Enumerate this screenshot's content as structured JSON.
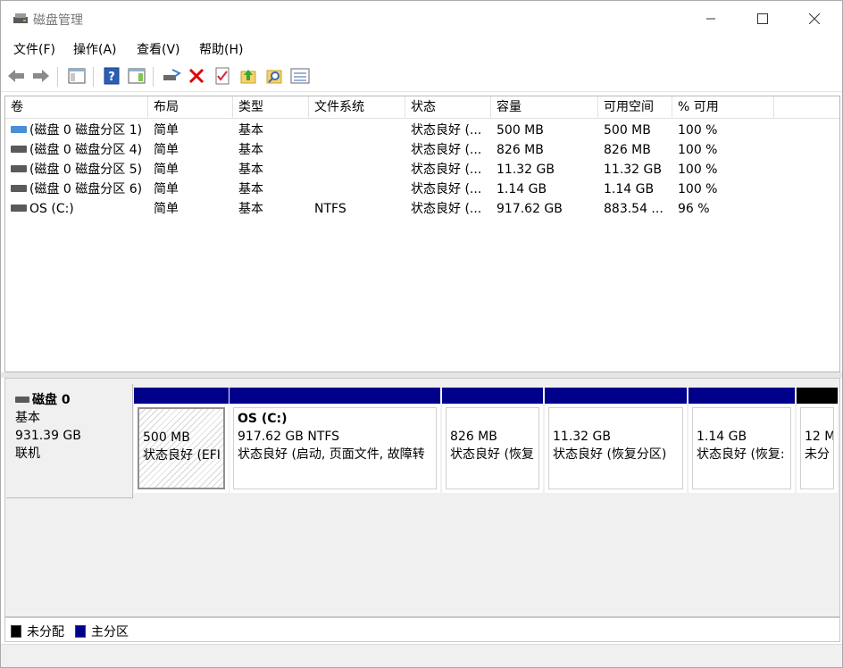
{
  "window": {
    "title": "磁盘管理"
  },
  "menu": [
    {
      "label": "文件(F)"
    },
    {
      "label": "操作(A)"
    },
    {
      "label": "查看(V)"
    },
    {
      "label": "帮助(H)"
    }
  ],
  "toolbar": {
    "icons": [
      "back-arrow-icon",
      "forward-arrow-icon",
      "console-tree-icon",
      "help-icon",
      "action-pane-icon",
      "connect-drive-icon",
      "delete-icon",
      "properties-check-icon",
      "up-folder-icon",
      "search-folder-icon",
      "settings-list-icon"
    ]
  },
  "volume_list": {
    "columns": [
      "卷",
      "布局",
      "类型",
      "文件系统",
      "状态",
      "容量",
      "可用空间",
      "% 可用"
    ],
    "rows": [
      {
        "volume": "(磁盘 0 磁盘分区 1)",
        "layout": "简单",
        "type": "基本",
        "fs": "",
        "status": "状态良好 (...",
        "capacity": "500 MB",
        "free": "500 MB",
        "pct": "100 %"
      },
      {
        "volume": "(磁盘 0 磁盘分区 4)",
        "layout": "简单",
        "type": "基本",
        "fs": "",
        "status": "状态良好 (...",
        "capacity": "826 MB",
        "free": "826 MB",
        "pct": "100 %"
      },
      {
        "volume": "(磁盘 0 磁盘分区 5)",
        "layout": "简单",
        "type": "基本",
        "fs": "",
        "status": "状态良好 (...",
        "capacity": "11.32 GB",
        "free": "11.32 GB",
        "pct": "100 %"
      },
      {
        "volume": "(磁盘 0 磁盘分区 6)",
        "layout": "简单",
        "type": "基本",
        "fs": "",
        "status": "状态良好 (...",
        "capacity": "1.14 GB",
        "free": "1.14 GB",
        "pct": "100 %"
      },
      {
        "volume": "OS (C:)",
        "layout": "简单",
        "type": "基本",
        "fs": "NTFS",
        "status": "状态良好 (...",
        "capacity": "917.62 GB",
        "free": "883.54 ...",
        "pct": "96 %"
      }
    ]
  },
  "disk": {
    "name": "磁盘 0",
    "type": "基本",
    "size": "931.39 GB",
    "state": "联机",
    "partitions": [
      {
        "title": "",
        "size": "500 MB",
        "status": "状态良好 (EFI"
      },
      {
        "title": "OS  (C:)",
        "size": "917.62 GB NTFS",
        "status": "状态良好 (启动, 页面文件, 故障转"
      },
      {
        "title": "",
        "size": "826 MB",
        "status": "状态良好 (恢复"
      },
      {
        "title": "",
        "size": "11.32 GB",
        "status": "状态良好 (恢复分区)"
      },
      {
        "title": "",
        "size": "1.14 GB",
        "status": "状态良好 (恢复:"
      },
      {
        "title": "",
        "size": "12 M",
        "status": "未分"
      }
    ]
  },
  "legend": [
    {
      "label": "未分配",
      "color": "#000000"
    },
    {
      "label": "主分区",
      "color": "#00008b"
    }
  ]
}
